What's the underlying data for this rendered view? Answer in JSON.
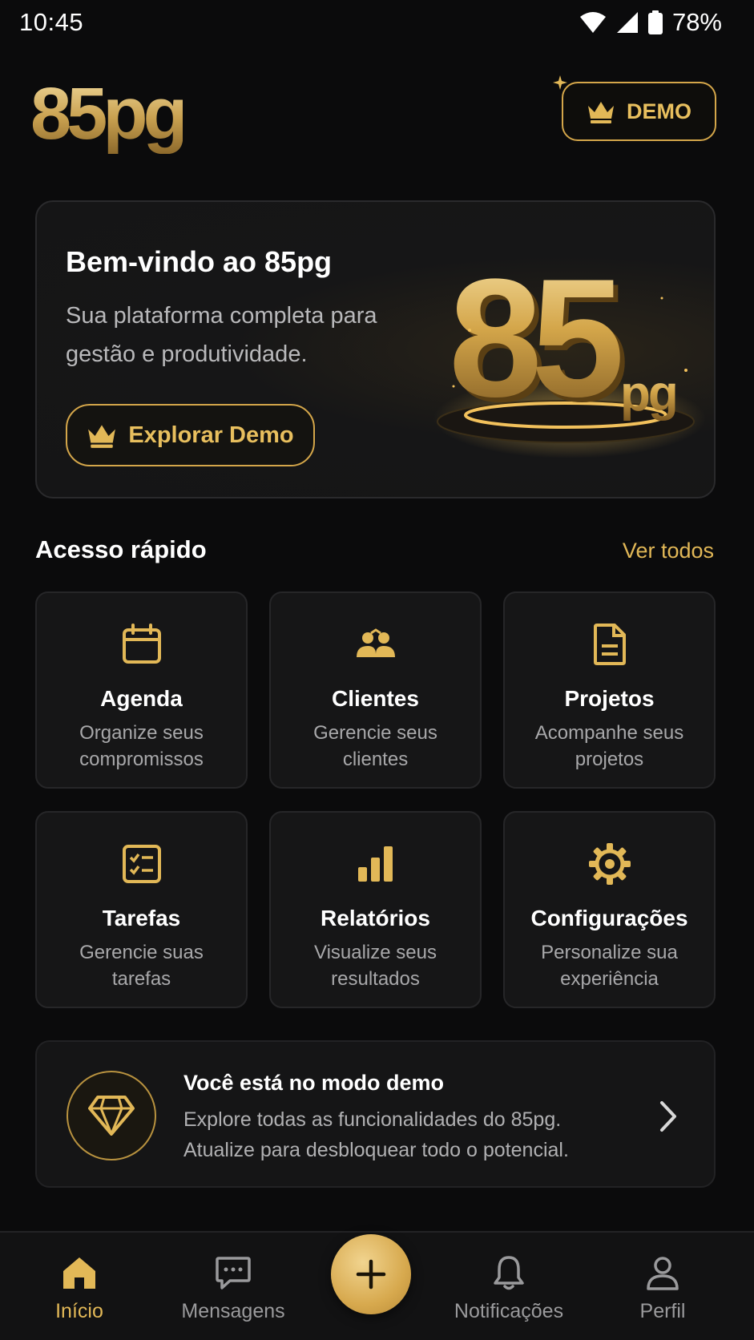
{
  "status_bar": {
    "time": "10:45",
    "battery": "78%"
  },
  "header": {
    "logo_text": "85pg",
    "demo_label": "DEMO"
  },
  "hero": {
    "title": "Bem-vindo ao 85pg",
    "subtitle": "Sua plataforma completa para gestão e produtividade.",
    "explore_label": "Explorar Demo",
    "art_big": "85",
    "art_small": "pg"
  },
  "quick_access": {
    "title": "Acesso rápido",
    "see_all": "Ver todos",
    "tiles": [
      {
        "icon": "calendar-icon",
        "title": "Agenda",
        "desc": "Organize seus compromissos"
      },
      {
        "icon": "users-icon",
        "title": "Clientes",
        "desc": "Gerencie seus clientes"
      },
      {
        "icon": "document-icon",
        "title": "Projetos",
        "desc": "Acompanhe seus projetos"
      },
      {
        "icon": "checklist-icon",
        "title": "Tarefas",
        "desc": "Gerencie suas tarefas"
      },
      {
        "icon": "bar-chart-icon",
        "title": "Relatórios",
        "desc": "Visualize seus resultados"
      },
      {
        "icon": "gear-icon",
        "title": "Configurações",
        "desc": "Personalize sua experiência"
      }
    ]
  },
  "demo_banner": {
    "title": "Você está no modo demo",
    "text": "Explore todas as funcionalidades do 85pg. Atualize para desbloquear todo o potencial."
  },
  "bottom_nav": {
    "items": [
      {
        "icon": "home-icon",
        "label": "Início",
        "active": true
      },
      {
        "icon": "message-icon",
        "label": "Mensagens",
        "active": false
      },
      {
        "icon": "bell-icon",
        "label": "Notificações",
        "active": false
      },
      {
        "icon": "user-icon",
        "label": "Perfil",
        "active": false
      }
    ],
    "fab_icon": "plus-icon"
  },
  "colors": {
    "accent": "#e2b857",
    "background": "#0b0b0c",
    "card": "#161617"
  }
}
